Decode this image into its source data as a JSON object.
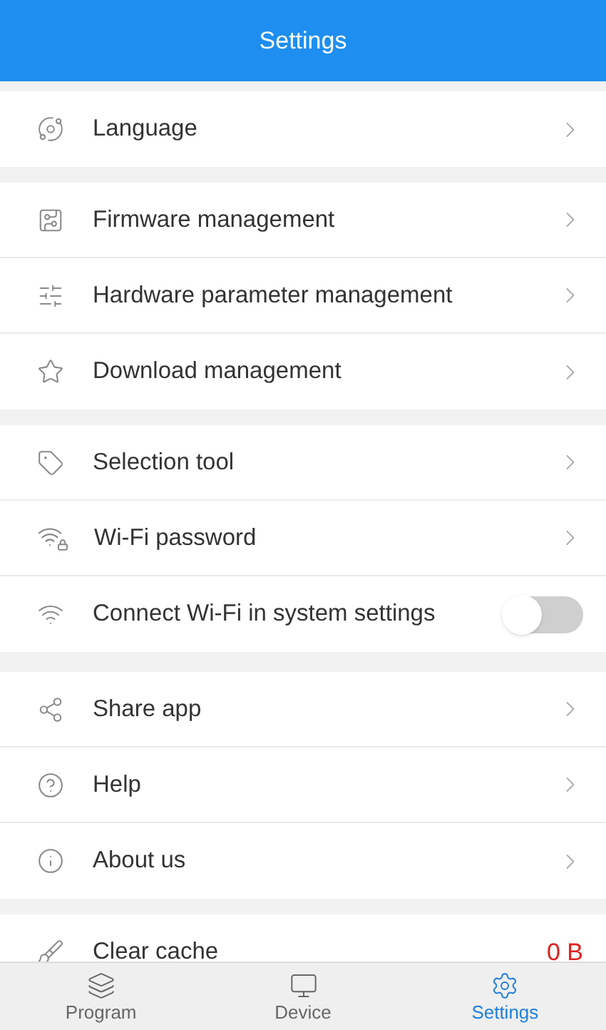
{
  "header": {
    "title": "Settings"
  },
  "groups": [
    {
      "items": [
        {
          "label": "Language",
          "kind": "chevron"
        }
      ]
    },
    {
      "items": [
        {
          "label": "Firmware management",
          "kind": "chevron"
        },
        {
          "label": "Hardware parameter management",
          "kind": "chevron"
        },
        {
          "label": "Download management",
          "kind": "chevron"
        }
      ]
    },
    {
      "items": [
        {
          "label": "Selection tool",
          "kind": "chevron"
        },
        {
          "label": "Wi-Fi password",
          "kind": "chevron"
        },
        {
          "label": "Connect Wi-Fi in system settings",
          "kind": "toggle",
          "on": false
        }
      ]
    },
    {
      "items": [
        {
          "label": "Share app",
          "kind": "chevron"
        },
        {
          "label": "Help",
          "kind": "chevron"
        },
        {
          "label": "About us",
          "kind": "chevron"
        }
      ]
    },
    {
      "items": [
        {
          "label": "Clear cache",
          "kind": "value",
          "value": "0 B"
        }
      ]
    }
  ],
  "tabs": [
    {
      "label": "Program",
      "selected": false
    },
    {
      "label": "Device",
      "selected": false
    },
    {
      "label": "Settings",
      "selected": true
    }
  ]
}
